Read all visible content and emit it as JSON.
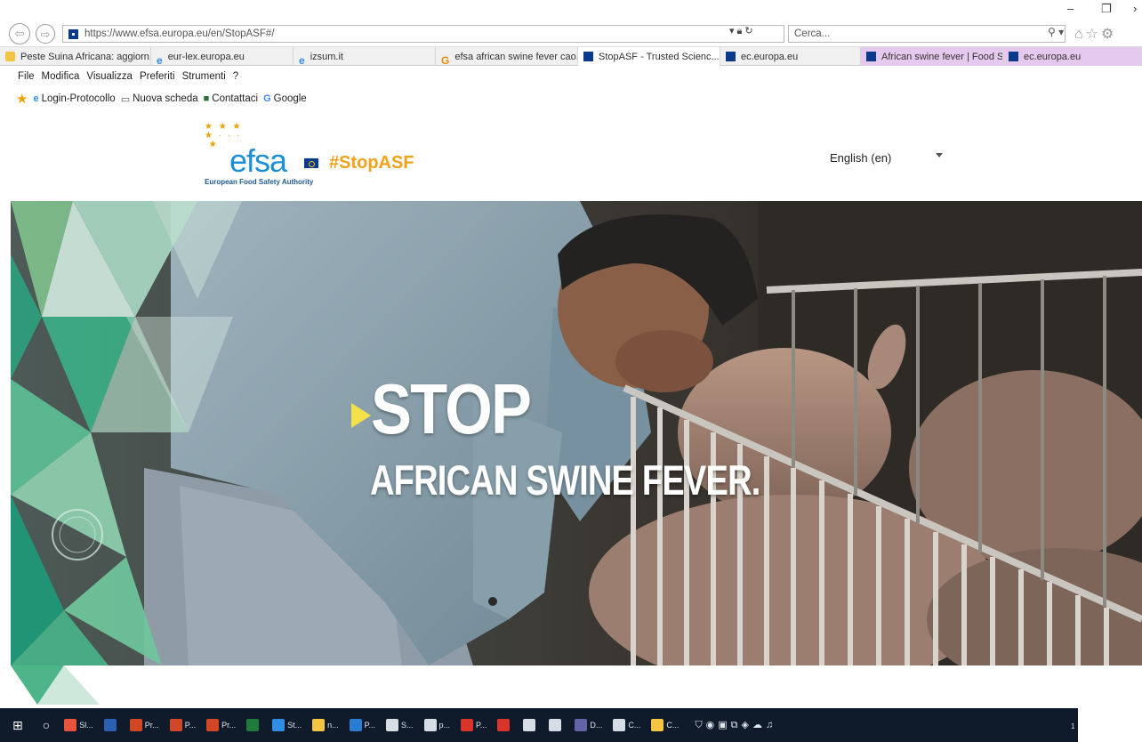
{
  "browser": {
    "url": "https://www.efsa.europa.eu/en/StopASF#/",
    "search_placeholder": "Cerca...",
    "tabs": [
      {
        "label": "Peste Suina Africana: aggiorn...",
        "icon": "yellow"
      },
      {
        "label": "eur-lex.europa.eu",
        "icon": "ie"
      },
      {
        "label": "izsum.it",
        "icon": "ie"
      },
      {
        "label": "efsa african swine fever cao...",
        "icon": "google"
      },
      {
        "label": "StopASF - Trusted Scienc...",
        "icon": "eu",
        "active": true
      },
      {
        "label": "ec.europa.eu",
        "icon": "eu"
      },
      {
        "label": "African swine fever | Food Sa...",
        "icon": "eu",
        "highlight": true
      },
      {
        "label": "ec.europa.eu",
        "icon": "eu"
      }
    ],
    "menu": [
      "File",
      "Modifica",
      "Visualizza",
      "Preferiti",
      "Strumenti",
      "?"
    ],
    "favorites": [
      {
        "label": "Login-Protocollo",
        "icon": "ie"
      },
      {
        "label": "Nuova scheda",
        "icon": "page"
      },
      {
        "label": "Contattaci",
        "icon": "contact"
      },
      {
        "label": "Google",
        "icon": "google"
      }
    ]
  },
  "site": {
    "logo_word": "efsa",
    "logo_subtitle": "European Food Safety Authority",
    "hashtag": "#StopASF",
    "language": "English (en)"
  },
  "hero": {
    "title": "STOP",
    "subtitle": "AFRICAN SWINE FEVER."
  },
  "taskbar": {
    "items": [
      {
        "label": "Sl...",
        "color": "#e8533b"
      },
      {
        "label": "",
        "color": "#2b5fb4"
      },
      {
        "label": "Pr...",
        "color": "#d24726"
      },
      {
        "label": "P...",
        "color": "#d24726"
      },
      {
        "label": "Pr...",
        "color": "#d24726"
      },
      {
        "label": "",
        "color": "#1f7a3c"
      },
      {
        "label": "St...",
        "color": "#2f8de4"
      },
      {
        "label": "n...",
        "color": "#f4c542"
      },
      {
        "label": "P...",
        "color": "#2b7cd3"
      },
      {
        "label": "S...",
        "color": "#d7dde5"
      },
      {
        "label": "p...",
        "color": "#d7dde5"
      },
      {
        "label": "P...",
        "color": "#d9342b"
      },
      {
        "label": "",
        "color": "#d9342b"
      },
      {
        "label": "",
        "color": "#d7dde5"
      },
      {
        "label": "",
        "color": "#d7dde5"
      },
      {
        "label": "D...",
        "color": "#6264a7"
      },
      {
        "label": "C...",
        "color": "#d7dde5"
      },
      {
        "label": "C...",
        "color": "#f4c542"
      }
    ],
    "clock": "1"
  }
}
